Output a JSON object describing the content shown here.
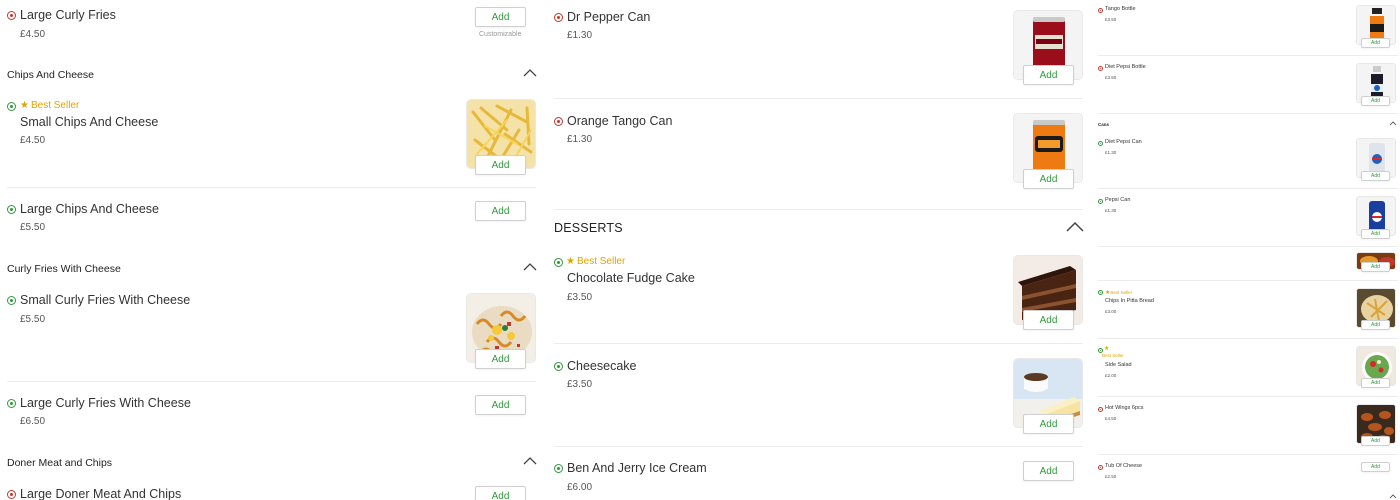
{
  "add_label": "Add",
  "best_seller_label": "Best Seller",
  "customizable_label": "Customizable",
  "colors": {
    "veg": "#2e9a3a",
    "nonveg": "#c0392b",
    "best_seller": "#e0a400",
    "add_text": "#2e9a3a"
  },
  "col1": {
    "top_item": {
      "name": "Large Curly Fries",
      "price": "£4.50",
      "type": "nonveg"
    },
    "categories": [
      {
        "title": "Chips And Cheese",
        "items": [
          {
            "name": "Small Chips And Cheese",
            "price": "£4.50",
            "type": "veg",
            "best_seller": true,
            "image": "chips-cheese"
          },
          {
            "name": "Large Chips And Cheese",
            "price": "£5.50",
            "type": "veg"
          }
        ]
      },
      {
        "title": "Curly Fries With Cheese",
        "items": [
          {
            "name": "Small Curly Fries With Cheese",
            "price": "£5.50",
            "type": "veg",
            "image": "curly-fries-cheese"
          },
          {
            "name": "Large Curly Fries With Cheese",
            "price": "£6.50",
            "type": "veg"
          }
        ]
      },
      {
        "title": "Doner Meat and Chips",
        "items": [
          {
            "name": "Large Doner Meat And Chips",
            "type": "nonveg"
          }
        ]
      }
    ]
  },
  "col2": {
    "items_top": [
      {
        "name": "Dr Pepper Can",
        "price": "£1.30",
        "type": "nonveg",
        "image": "dr-pepper-can"
      },
      {
        "name": "Orange Tango Can",
        "price": "£1.30",
        "type": "nonveg",
        "image": "tango-can"
      }
    ],
    "category": {
      "title": "DESSERTS",
      "items": [
        {
          "name": "Chocolate Fudge Cake",
          "price": "£3.50",
          "type": "veg",
          "best_seller": true,
          "image": "fudge-cake"
        },
        {
          "name": "Cheesecake",
          "price": "£3.50",
          "type": "veg",
          "image": "cheesecake"
        },
        {
          "name": "Ben And Jerry Ice Cream",
          "price": "£6.00",
          "type": "veg"
        }
      ]
    }
  },
  "col3": {
    "items_top": [
      {
        "name": "Tango Bottle",
        "price": "£3.50",
        "type": "nonveg",
        "image": "tango-bottle"
      },
      {
        "name": "Diet Pepsi Bottle",
        "price": "£3.50",
        "type": "nonveg",
        "image": "pepsi-bottle"
      }
    ],
    "cans": {
      "title": "Cans",
      "items": [
        {
          "name": "Diet Pepsi Can",
          "price": "£1.30",
          "type": "veg",
          "image": "diet-pepsi-can"
        },
        {
          "name": "Pepsi Can",
          "price": "£1.30",
          "type": "veg",
          "image": "pepsi-can"
        }
      ]
    },
    "items_bottom": [
      {
        "name": "Chips In Pitta Bread",
        "price": "£3.00",
        "type": "veg",
        "best_seller": true,
        "image": "chips-pitta"
      },
      {
        "name": "Side Salad",
        "price": "£2.00",
        "type": "veg",
        "best_seller": true,
        "image": "side-salad"
      },
      {
        "name": "Hot Wings 6pcs",
        "price": "£4.50",
        "type": "nonveg",
        "image": "hot-wings"
      },
      {
        "name": "Tub Of Cheese",
        "price": "£2.50",
        "type": "nonveg"
      }
    ]
  }
}
